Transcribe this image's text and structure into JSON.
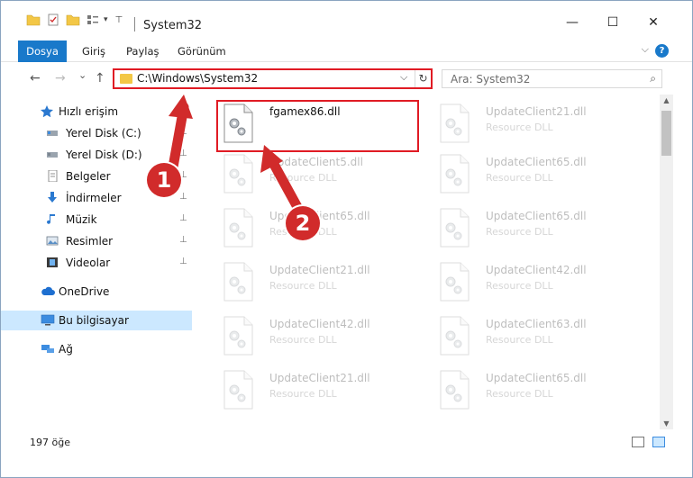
{
  "window": {
    "title": "System32",
    "minimize": "—",
    "maximize": "☐",
    "close": "✕"
  },
  "ribbon": {
    "tabs": [
      {
        "label": "Dosya"
      },
      {
        "label": "Giriş"
      },
      {
        "label": "Paylaş"
      },
      {
        "label": "Görünüm"
      }
    ],
    "help": "?",
    "collapse": "⌵"
  },
  "nav": {
    "back": "←",
    "forward": "→",
    "recent": "⌄",
    "up": "↑"
  },
  "address": {
    "path": "C:\\Windows\\System32",
    "dropdown": "⌵",
    "refresh": "↻"
  },
  "search": {
    "placeholder": "Ara: System32",
    "icon": "⌕"
  },
  "sidebar": {
    "quick_access": "Hızlı erişim",
    "items": [
      {
        "label": "Yerel Disk (C:)"
      },
      {
        "label": "Yerel Disk (D:)"
      },
      {
        "label": "Belgeler"
      },
      {
        "label": "İndirmeler"
      },
      {
        "label": "Müzik"
      },
      {
        "label": "Resimler"
      },
      {
        "label": "Videolar"
      }
    ],
    "onedrive": "OneDrive",
    "this_pc": "Bu bilgisayar",
    "network": "Ağ",
    "pin": "📌"
  },
  "files": {
    "main": {
      "name": "fgamex86.dll"
    },
    "faded": [
      {
        "name": "UpdateClient21.dll",
        "type": "Resource DLL"
      },
      {
        "name": "UpdateClient5.dll",
        "type": "Resource DLL"
      },
      {
        "name": "UpdateClient65.dll",
        "type": "Resource DLL"
      },
      {
        "name": "UpdateClient65.dll",
        "type": "Resource DLL"
      },
      {
        "name": "UpdateClient65.dll",
        "type": "Resource DLL"
      },
      {
        "name": "UpdateClient21.dll",
        "type": "Resource DLL"
      },
      {
        "name": "UpdateClient42.dll",
        "type": "Resource DLL"
      },
      {
        "name": "UpdateClient42.dll",
        "type": "Resource DLL"
      },
      {
        "name": "UpdateClient63.dll",
        "type": "Resource DLL"
      },
      {
        "name": "UpdateClient21.dll",
        "type": "Resource DLL"
      },
      {
        "name": "UpdateClient65.dll",
        "type": "Resource DLL"
      }
    ]
  },
  "status": {
    "count": "197 öğe"
  },
  "annotations": {
    "step1": "1",
    "step2": "2",
    "color": "#d12b2b"
  }
}
